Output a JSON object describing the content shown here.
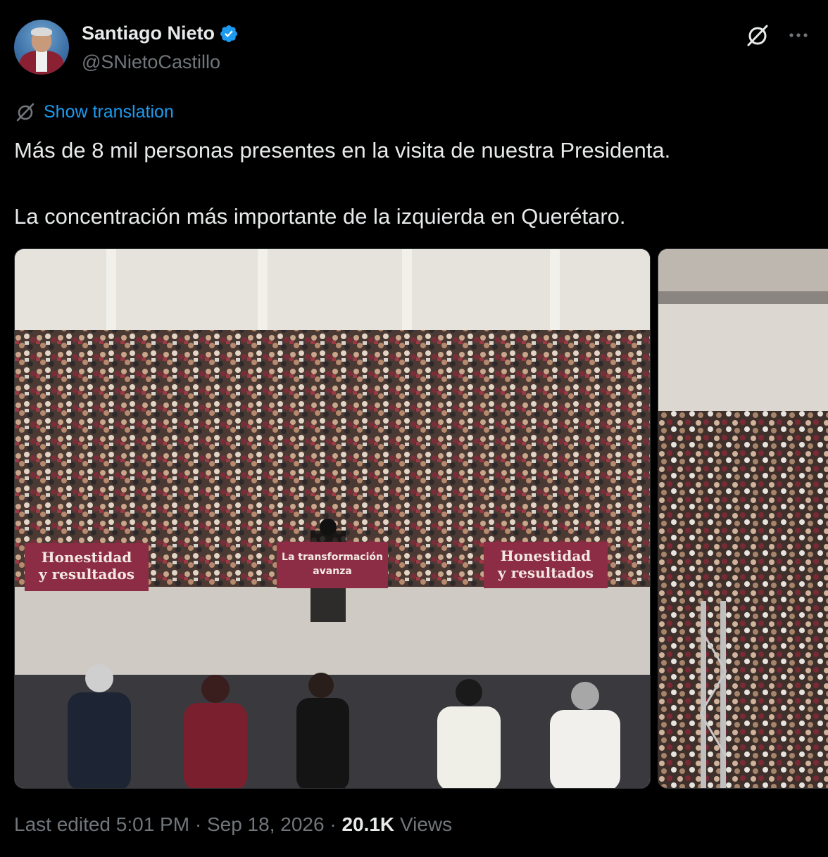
{
  "author": {
    "display_name": "Santiago Nieto",
    "handle": "@SNietoCastillo",
    "verified": true,
    "verified_color": "#1d9bf0"
  },
  "actions": {
    "grok_icon": "grok-icon",
    "more_icon": "more-horizontal-icon"
  },
  "translation": {
    "label": "Show translation",
    "icon": "grok-icon"
  },
  "post": {
    "paragraphs": [
      "Más de 8 mil personas presentes en la visita de nuestra Presidenta.",
      "La concentración más importante de la izquierda en Querétaro."
    ]
  },
  "media": {
    "photo1": {
      "banner_left": [
        "Honestidad",
        "y resultados"
      ],
      "banner_middle": [
        "La transformación",
        "avanza"
      ],
      "banner_right": [
        "Honestidad",
        "y resultados"
      ]
    }
  },
  "footer": {
    "edited_label": "Last edited",
    "time": "5:01 PM",
    "separator": "·",
    "date": "Sep 18, 2026",
    "views_count": "20.1K",
    "views_label": "Views"
  },
  "colors": {
    "background": "#000000",
    "text": "#e7e9ea",
    "muted": "#71767b",
    "link": "#1d9bf0",
    "banner": "#8c2d45"
  }
}
